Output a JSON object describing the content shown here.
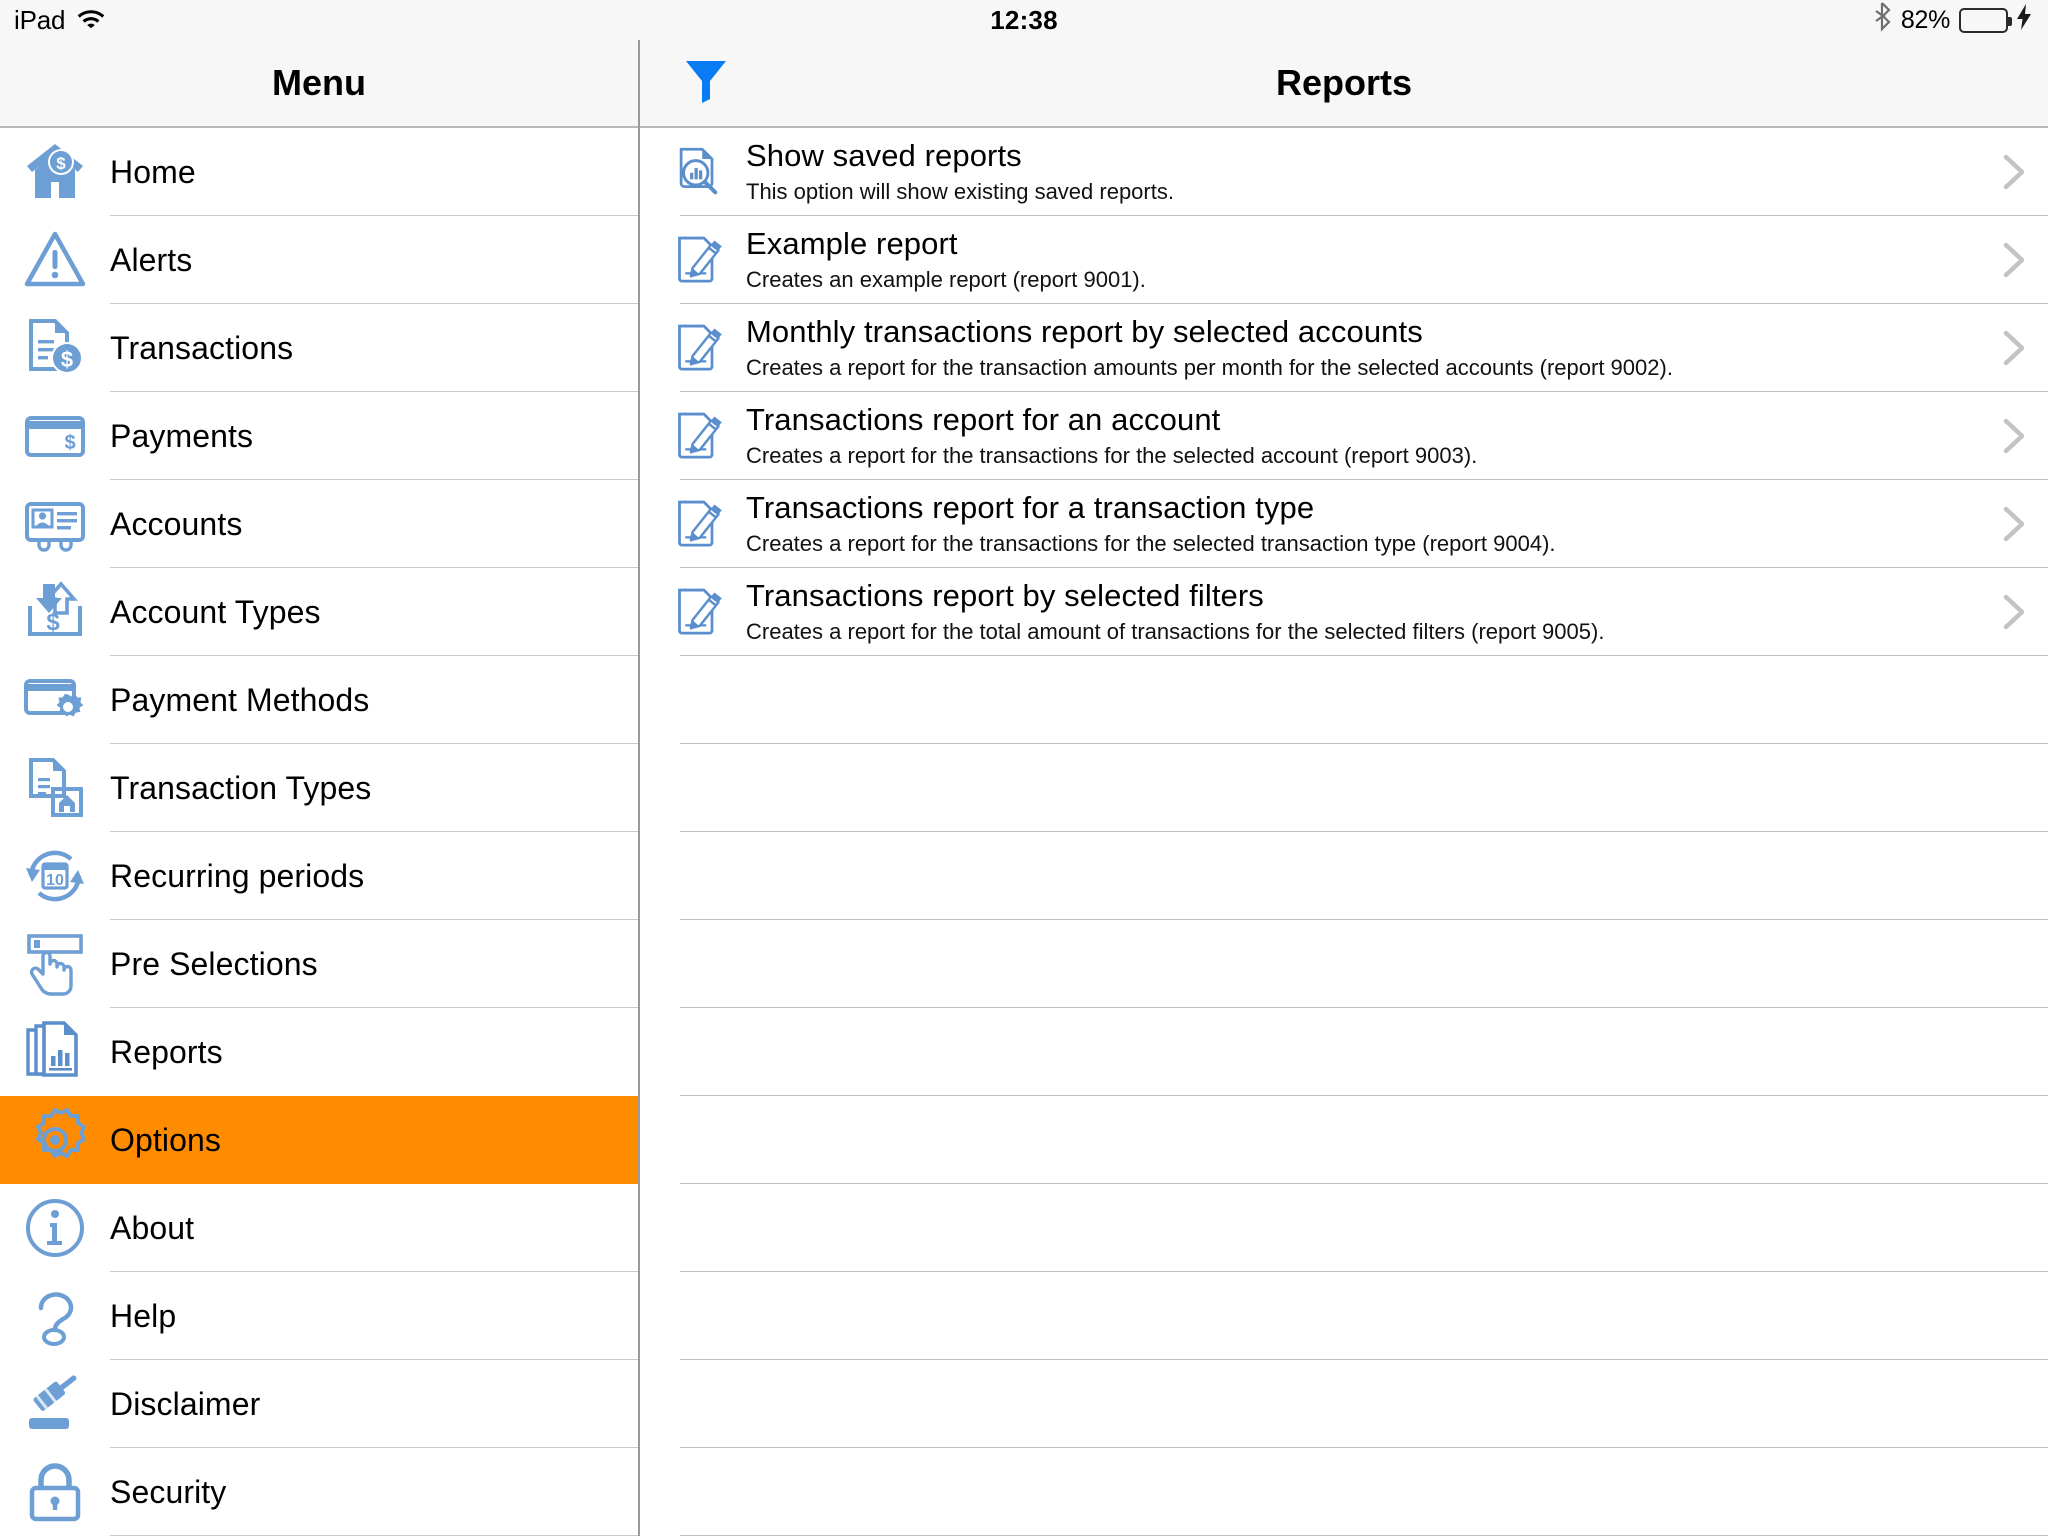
{
  "status_bar": {
    "carrier": "iPad",
    "wifi_icon": "wifi-icon",
    "time": "12:38",
    "bluetooth_icon": "bluetooth-icon",
    "battery_percent": "82%",
    "battery_level": 82,
    "battery_color": "#4cd562",
    "charging_icon": "lightning-bolt-icon"
  },
  "sidebar": {
    "title": "Menu",
    "selected_index": 11,
    "selected_color": "#ff8c00",
    "items": [
      {
        "label": "Home",
        "icon": "house-dollar-icon"
      },
      {
        "label": "Alerts",
        "icon": "warning-triangle-icon"
      },
      {
        "label": "Transactions",
        "icon": "document-dollar-icon"
      },
      {
        "label": "Payments",
        "icon": "credit-card-dollar-icon"
      },
      {
        "label": "Accounts",
        "icon": "id-card-icon"
      },
      {
        "label": "Account Types",
        "icon": "arrows-dollar-box-icon"
      },
      {
        "label": "Payment Methods",
        "icon": "credit-card-gear-icon"
      },
      {
        "label": "Transaction Types",
        "icon": "document-house-icon"
      },
      {
        "label": "Recurring periods",
        "icon": "recurring-calendar-icon"
      },
      {
        "label": "Pre Selections",
        "icon": "hand-pointer-field-icon"
      },
      {
        "label": "Reports",
        "icon": "documents-chart-icon"
      },
      {
        "label": "Options",
        "icon": "gear-icon"
      },
      {
        "label": "About",
        "icon": "info-circle-icon"
      },
      {
        "label": "Help",
        "icon": "question-mark-icon"
      },
      {
        "label": "Disclaimer",
        "icon": "gavel-icon"
      },
      {
        "label": "Security",
        "icon": "padlock-icon"
      }
    ]
  },
  "detail": {
    "title": "Reports",
    "filter_icon": "funnel-filter-icon",
    "filter_color": "#0a7cf3",
    "chevron_icon": "chevron-right-icon",
    "rows": [
      {
        "title": "Show saved reports",
        "description": "This option will show existing saved reports.",
        "icon": "report-search-icon"
      },
      {
        "title": "Example report",
        "description": "Creates an example report (report 9001).",
        "icon": "document-pencil-icon"
      },
      {
        "title": "Monthly transactions report by selected accounts",
        "description": "Creates a report for the transaction amounts per month for the selected accounts (report 9002).",
        "icon": "document-pencil-icon"
      },
      {
        "title": "Transactions report for an account",
        "description": "Creates a report for the transactions for the selected account (report 9003).",
        "icon": "document-pencil-icon"
      },
      {
        "title": "Transactions report for a transaction type",
        "description": "Creates a report for the transactions for the selected transaction type (report 9004).",
        "icon": "document-pencil-icon"
      },
      {
        "title": "Transactions report by selected filters",
        "description": "Creates a report for the total amount of transactions for the selected filters (report 9005).",
        "icon": "document-pencil-icon"
      }
    ],
    "empty_row_count": 10
  }
}
